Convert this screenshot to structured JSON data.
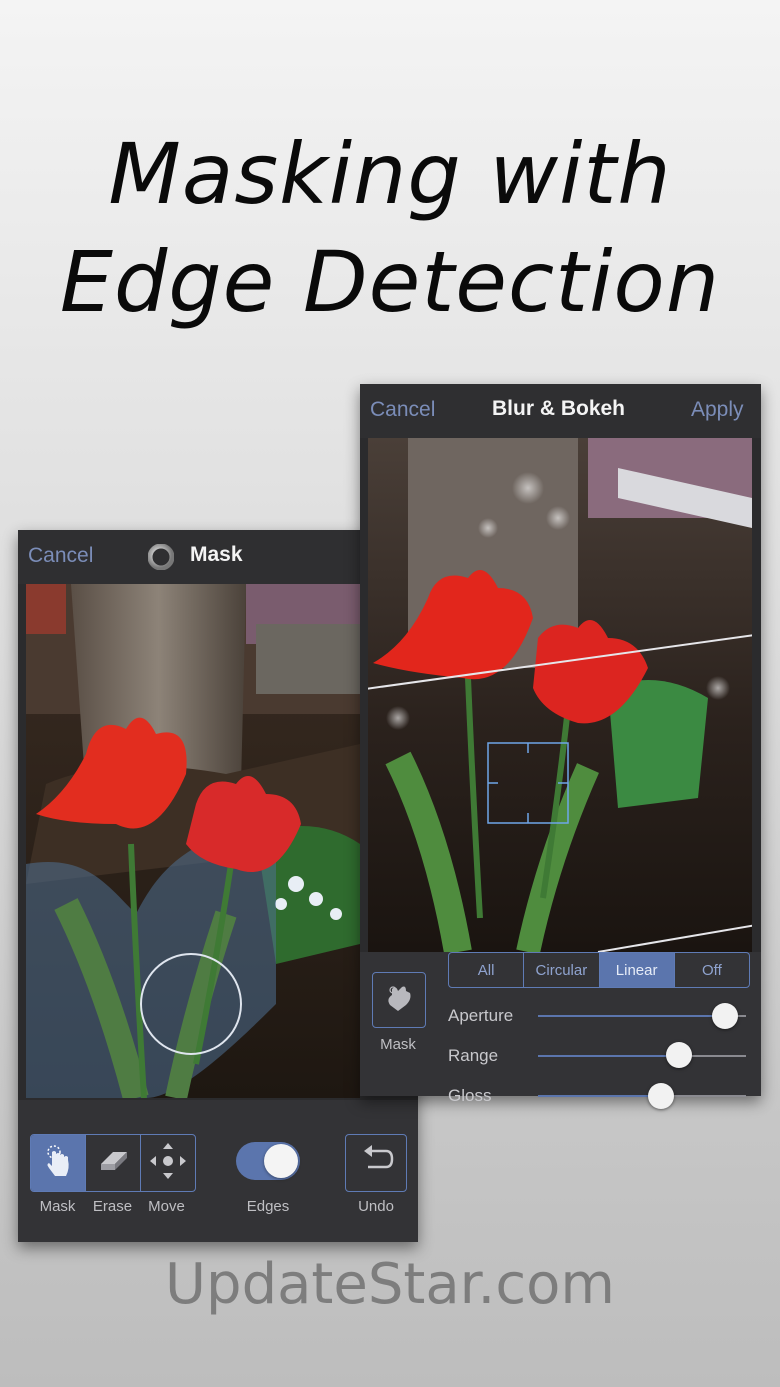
{
  "headline": {
    "line1": "Masking with",
    "line2": "Edge Detection"
  },
  "mask_screen": {
    "cancel": "Cancel",
    "title": "Mask",
    "tools": {
      "mask": "Mask",
      "erase": "Erase",
      "move": "Move",
      "edges": "Edges",
      "undo": "Undo"
    },
    "edges_toggle_on": true,
    "icons": {
      "title": "ring-icon",
      "mask": "hand-touch-icon",
      "erase": "eraser-icon",
      "move": "move-arrows-icon",
      "undo": "undo-icon"
    }
  },
  "blur_screen": {
    "cancel": "Cancel",
    "title": "Blur & Bokeh",
    "apply": "Apply",
    "mask_button": "Mask",
    "modes": [
      "All",
      "Circular",
      "Linear",
      "Off"
    ],
    "selected_mode": "Linear",
    "sliders": [
      {
        "label": "Aperture",
        "value": 0.9
      },
      {
        "label": "Range",
        "value": 0.68
      },
      {
        "label": "Gloss",
        "value": 0.59
      }
    ]
  },
  "watermark": "UpdateStar.com",
  "colors": {
    "accent": "#5b75ad",
    "nav_link": "#7b8db8",
    "panel": "#2b2b2d"
  }
}
